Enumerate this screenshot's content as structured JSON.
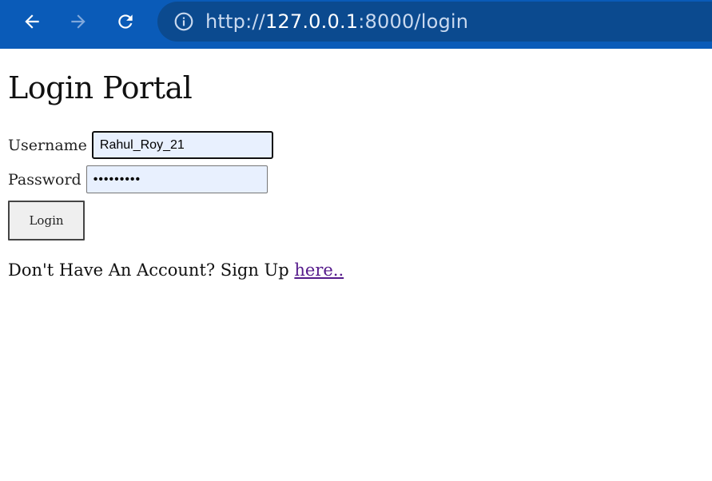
{
  "browser": {
    "url_scheme": "http://",
    "url_host": "127.0.0.1",
    "url_path": ":8000/login",
    "bar_color": "#0a5bb8",
    "icons": [
      "back-arrow-icon",
      "forward-arrow-icon",
      "reload-icon",
      "info-icon"
    ]
  },
  "page": {
    "title": "Login Portal",
    "username_label": "Username",
    "username_value": "Rahul_Roy_21",
    "password_label": "Password",
    "password_value": "•••••••••",
    "login_label": "Login",
    "signup_prompt": "Don't Have An Account? Sign Up ",
    "signup_link": "here.."
  }
}
